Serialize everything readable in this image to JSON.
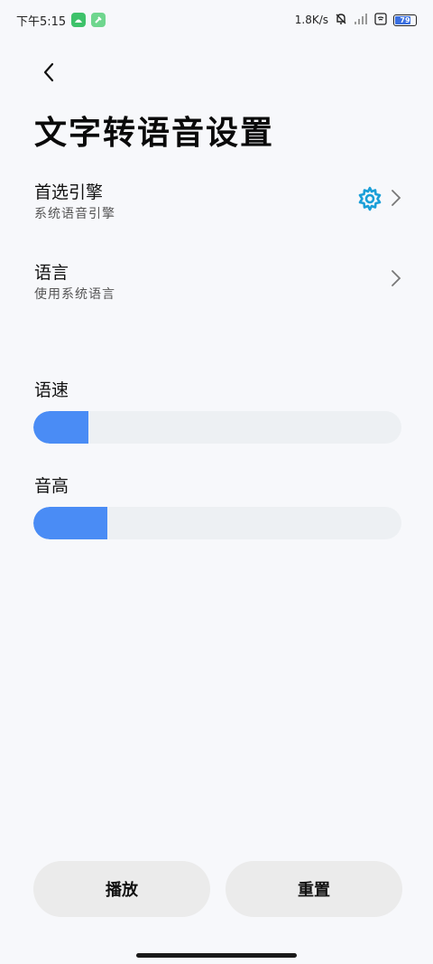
{
  "status_bar": {
    "time": "下午5:15",
    "net_speed": "1.8K/s",
    "battery_level": "79",
    "battery_fraction": 0.79
  },
  "page": {
    "title": "文字转语音设置"
  },
  "settings": {
    "engine": {
      "title": "首选引擎",
      "subtitle": "系统语音引擎"
    },
    "language": {
      "title": "语言",
      "subtitle": "使用系统语言"
    }
  },
  "sliders": {
    "rate": {
      "label": "语速",
      "value_fraction": 0.15
    },
    "pitch": {
      "label": "音高",
      "value_fraction": 0.2
    }
  },
  "buttons": {
    "play": "播放",
    "reset": "重置"
  },
  "colors": {
    "accent": "#4a8cf5",
    "gear": "#1a9fd8",
    "background": "#f7f8fb"
  },
  "icons": {
    "back": "back-arrow-icon",
    "gear": "gear-icon",
    "chevron": "chevron-right-icon"
  }
}
